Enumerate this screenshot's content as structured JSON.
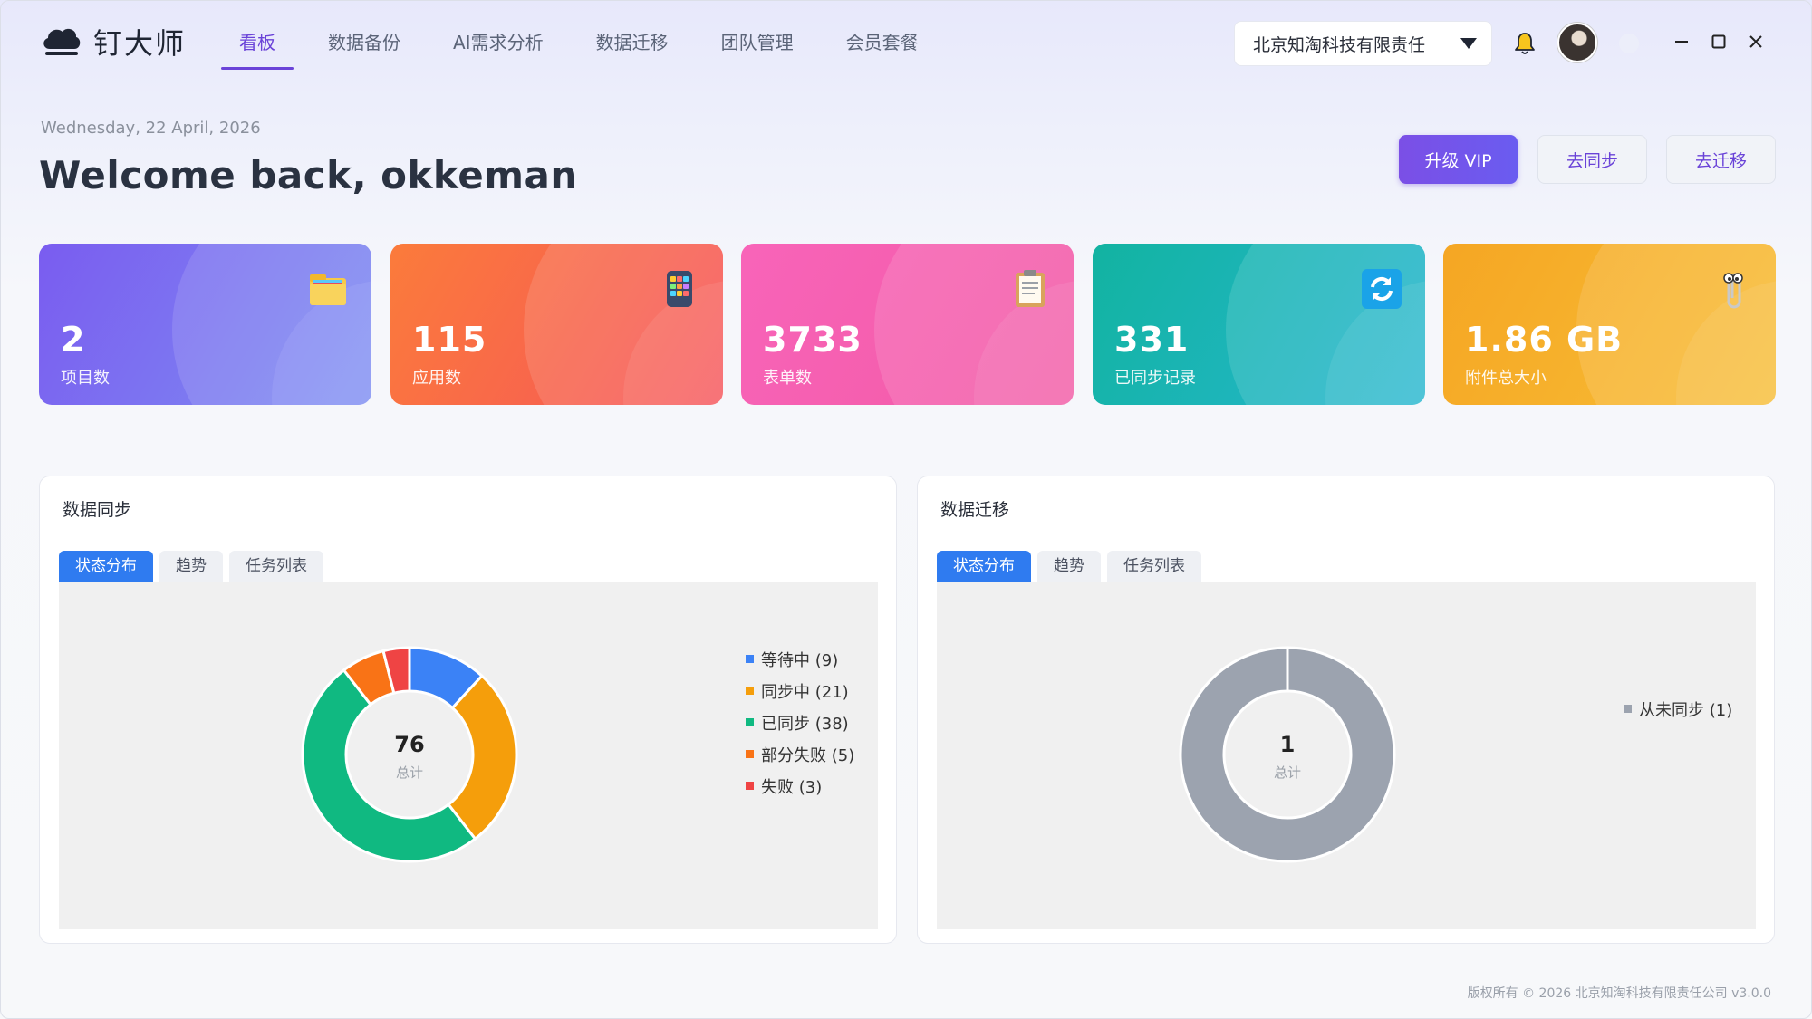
{
  "app": {
    "name": "钉大师"
  },
  "nav": {
    "items": [
      {
        "label": "看板",
        "active": true
      },
      {
        "label": "数据备份",
        "active": false
      },
      {
        "label": "AI需求分析",
        "active": false
      },
      {
        "label": "数据迁移",
        "active": false
      },
      {
        "label": "团队管理",
        "active": false
      },
      {
        "label": "会员套餐",
        "active": false
      }
    ]
  },
  "org": {
    "selected": "北京知淘科技有限责任"
  },
  "header": {
    "date": "Wednesday, 22 April, 2026",
    "welcome": "Welcome back, okkeman",
    "buttons": {
      "vip": "升级 VIP",
      "sync": "去同步",
      "migrate": "去迁移"
    }
  },
  "stats": [
    {
      "value": "2",
      "label": "项目数",
      "icon": "folder-icon"
    },
    {
      "value": "115",
      "label": "应用数",
      "icon": "app-grid-icon"
    },
    {
      "value": "3733",
      "label": "表单数",
      "icon": "clipboard-icon"
    },
    {
      "value": "331",
      "label": "已同步记录",
      "icon": "sync-icon"
    },
    {
      "value": "1.86 GB",
      "label": "附件总大小",
      "icon": "paperclip-icon"
    }
  ],
  "sync_panel": {
    "title": "数据同步",
    "tabs": [
      "状态分布",
      "趋势",
      "任务列表"
    ],
    "total": "76",
    "total_label": "总计",
    "legend": [
      "等待中 (9)",
      "同步中 (21)",
      "已同步 (38)",
      "部分失败 (5)",
      "失败 (3)"
    ]
  },
  "migrate_panel": {
    "title": "数据迁移",
    "tabs": [
      "状态分布",
      "趋势",
      "任务列表"
    ],
    "total": "1",
    "total_label": "总计",
    "legend": [
      "从未同步 (1)"
    ]
  },
  "chart_data": [
    {
      "type": "pie",
      "title": "",
      "categories": [
        "等待中",
        "同步中",
        "已同步",
        "部分失败",
        "失败"
      ],
      "values": [
        9,
        21,
        38,
        5,
        3
      ],
      "colors": [
        "#3b82f6",
        "#f59e0b",
        "#10b981",
        "#f97316",
        "#ef4444"
      ],
      "legend_position": "right"
    },
    {
      "type": "pie",
      "title": "",
      "categories": [
        "从未同步"
      ],
      "values": [
        1
      ],
      "colors": [
        "#9ca3af"
      ],
      "legend_position": "right"
    }
  ],
  "footer": {
    "text": "版权所有 © 2026 北京知淘科技有限责任公司  v3.0.0"
  },
  "colors": {
    "accent": "#6a43d8",
    "tab_active": "#2f7bf0"
  }
}
